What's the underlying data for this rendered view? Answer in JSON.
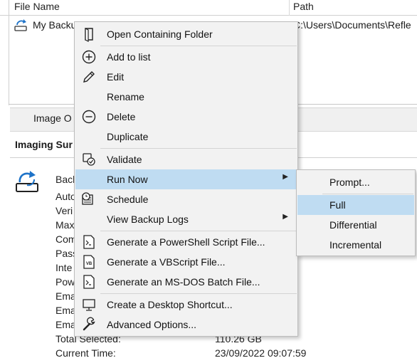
{
  "file_list": {
    "columns": {
      "name": "File Name",
      "path": "Path"
    },
    "row": {
      "name": "My Backu",
      "path": "C:\\Users\\Documents\\Refle"
    }
  },
  "tabs": {
    "image_tab": "Image O"
  },
  "summary": {
    "title": "Imaging Sur",
    "labels": [
      "Back",
      "Auto",
      "Veri",
      "Max",
      "Com",
      "Pass",
      "Inte",
      "Pow",
      "Ema",
      "Ema",
      "Ema",
      "Total Selected:",
      "Current Time:"
    ],
    "values": {
      "total_selected": "110.26 GB",
      "current_time": "23/09/2022 09:07:59"
    }
  },
  "context_menu": {
    "items": [
      {
        "label": "Open Containing Folder",
        "icon": "folder-icon"
      },
      {
        "label": "Add to list",
        "icon": "add-circle-icon"
      },
      {
        "label": "Edit",
        "icon": "pencil-icon"
      },
      {
        "label": "Rename",
        "icon": ""
      },
      {
        "label": "Delete",
        "icon": "minus-circle-icon"
      },
      {
        "label": "Duplicate",
        "icon": ""
      },
      {
        "label": "Validate",
        "icon": "validate-icon"
      },
      {
        "label": "Run Now",
        "icon": ""
      },
      {
        "label": "Schedule",
        "icon": "schedule-icon"
      },
      {
        "label": "View Backup Logs",
        "icon": ""
      },
      {
        "label": "Generate a PowerShell Script File...",
        "icon": "powershell-file-icon"
      },
      {
        "label": "Generate a VBScript File...",
        "icon": "vbscript-file-icon"
      },
      {
        "label": "Generate an MS-DOS Batch File...",
        "icon": "batch-file-icon"
      },
      {
        "label": "Create a Desktop Shortcut...",
        "icon": "monitor-icon"
      },
      {
        "label": "Advanced Options...",
        "icon": "wrench-icon"
      }
    ]
  },
  "run_now_submenu": {
    "items": [
      {
        "label": "Prompt..."
      },
      {
        "label": "Full"
      },
      {
        "label": "Differential"
      },
      {
        "label": "Incremental"
      }
    ]
  },
  "colors": {
    "highlight": "#bfdcf2",
    "menu_bg": "#f2f2f2",
    "accent_blue": "#1e73c8"
  }
}
